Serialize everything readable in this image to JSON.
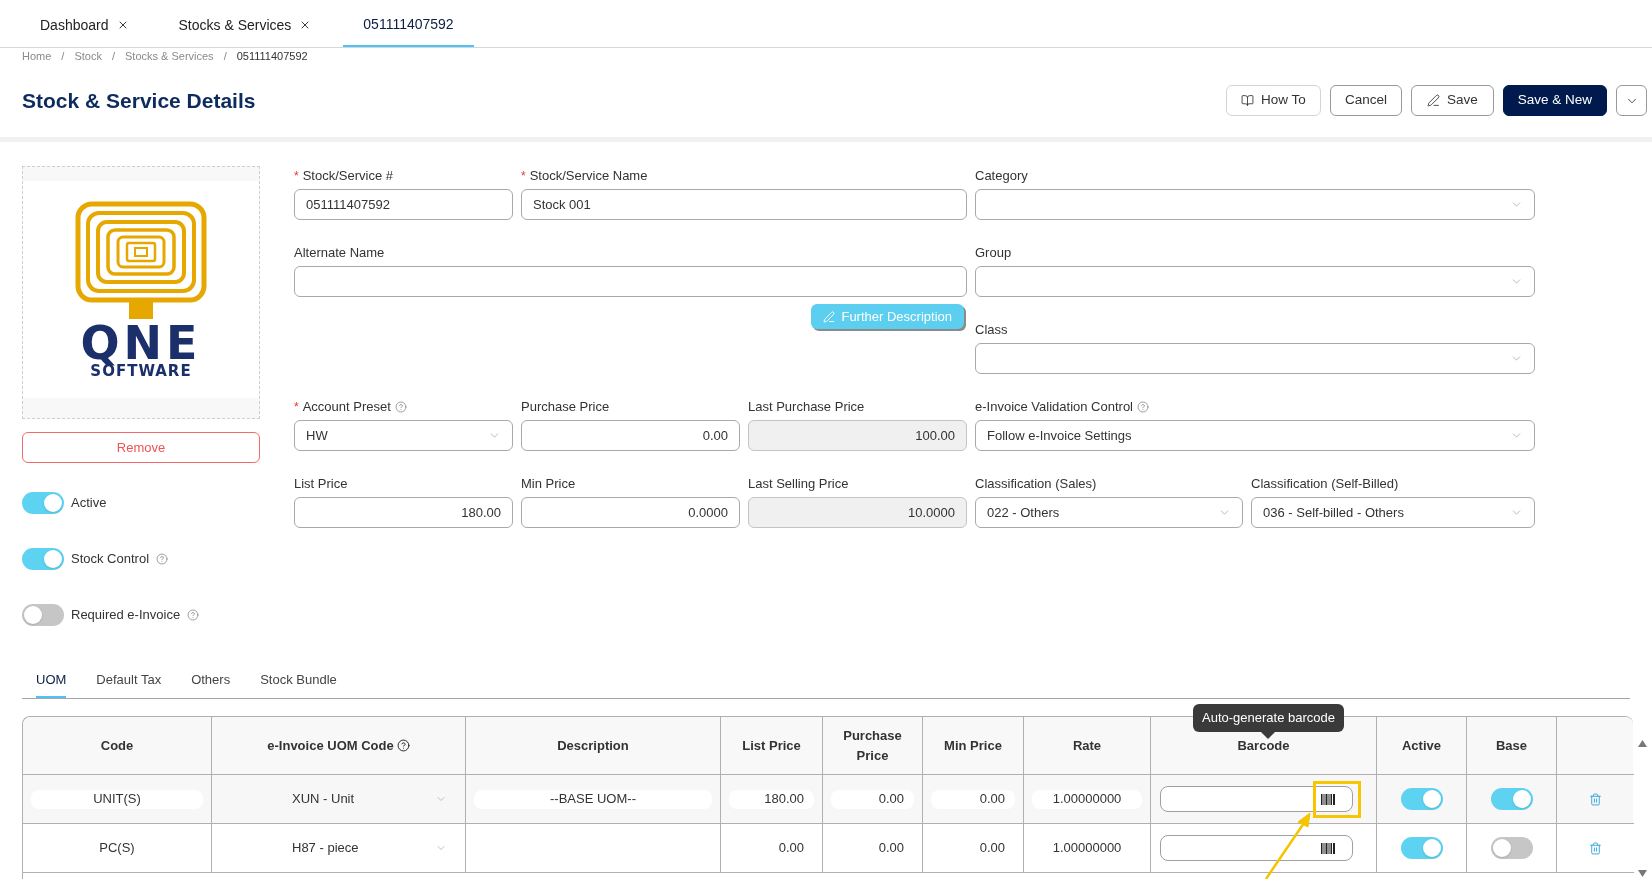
{
  "tabs": [
    {
      "label": "Dashboard",
      "closable": true,
      "selected": false
    },
    {
      "label": "Stocks & Services",
      "closable": true,
      "selected": false
    },
    {
      "label": "051111407592",
      "closable": false,
      "selected": true
    }
  ],
  "breadcrumb": [
    "Home",
    "Stock",
    "Stocks & Services",
    "051111407592"
  ],
  "title": "Stock & Service Details",
  "actions": [
    {
      "kind": "book",
      "label": "How To"
    },
    {
      "kind": "plain",
      "label": "Cancel"
    },
    {
      "kind": "pencil",
      "label": "Save"
    },
    {
      "kind": "primary",
      "label": "Save & New"
    },
    {
      "kind": "dropdown"
    }
  ],
  "image": {
    "logo_text": "QNE",
    "logo_subtext": "SOFTWARE"
  },
  "remove_button": "Remove",
  "toggles": [
    {
      "label": "Active",
      "on": true,
      "help": false
    },
    {
      "label": "Stock Control",
      "on": true,
      "help": true
    },
    {
      "label": "Required e-Invoice",
      "on": false,
      "help": true
    }
  ],
  "fields": [
    {
      "label": "Stock/Service #",
      "required": true,
      "help": false,
      "kind": "text",
      "value": "051111407592"
    },
    {
      "label": "Stock/Service Name",
      "required": true,
      "help": false,
      "kind": "text",
      "value": "Stock 001"
    },
    {
      "label": "Category",
      "required": false,
      "help": false,
      "kind": "select"
    },
    {
      "label": "Alternate Name",
      "required": false,
      "help": false,
      "kind": "text"
    },
    {
      "label": "Group",
      "required": false,
      "help": false,
      "kind": "select"
    },
    {
      "label": "Class",
      "required": false,
      "help": false,
      "kind": "select"
    },
    {
      "label": "Account Preset",
      "required": true,
      "help": true,
      "kind": "select",
      "value": "HW"
    },
    {
      "label": "Purchase Price",
      "required": false,
      "help": false,
      "kind": "number",
      "value": "0.00"
    },
    {
      "label": "Last Purchase Price",
      "required": false,
      "help": false,
      "kind": "readonly",
      "value": "100.00"
    },
    {
      "label": "e-Invoice Validation Control",
      "required": false,
      "help": true,
      "kind": "select",
      "value": "Follow e-Invoice Settings"
    },
    {
      "label": "List Price",
      "required": false,
      "help": false,
      "kind": "number",
      "value": "180.00"
    },
    {
      "label": "Min Price",
      "required": false,
      "help": false,
      "kind": "number",
      "value": "0.0000"
    },
    {
      "label": "Last Selling Price",
      "required": false,
      "help": false,
      "kind": "readonly",
      "value": "10.0000"
    },
    {
      "label": "Classification (Sales)",
      "required": false,
      "help": false,
      "kind": "select",
      "value": "022 - Others"
    },
    {
      "label": "Classification (Self-Billed)",
      "required": false,
      "help": false,
      "kind": "select",
      "value": "036 - Self-billed - Others"
    }
  ],
  "further_description": "Further Description",
  "detail_tabs": [
    {
      "label": "UOM",
      "selected": true
    },
    {
      "label": "Default Tax",
      "selected": false
    },
    {
      "label": "Others",
      "selected": false
    },
    {
      "label": "Stock Bundle",
      "selected": false
    }
  ],
  "table": {
    "columns": [
      {
        "label": "Code",
        "help": false
      },
      {
        "label": "e-Invoice UOM Code",
        "help": true
      },
      {
        "label": "Description",
        "help": false
      },
      {
        "label": "List Price",
        "help": false
      },
      {
        "label": "Purchase Price",
        "help": false
      },
      {
        "label": "Min Price",
        "help": false
      },
      {
        "label": "Rate",
        "help": false
      },
      {
        "label": "Barcode",
        "help": false
      },
      {
        "label": "Active",
        "help": false
      },
      {
        "label": "Base",
        "help": false
      }
    ],
    "rows": [
      {
        "editing": true,
        "code": "UNIT(S)",
        "uom_code": "XUN - Unit",
        "description": "--BASE UOM--",
        "list_price": "180.00",
        "purchase_price": "0.00",
        "min_price": "0.00",
        "rate": "1.00000000",
        "active": true,
        "base": true
      },
      {
        "editing": false,
        "code": "PC(S)",
        "uom_code": "H87 - piece",
        "list_price": "0.00",
        "purchase_price": "0.00",
        "min_price": "0.00",
        "rate": "1.00000000",
        "active": true,
        "base": false
      }
    ]
  },
  "tooltip": "Auto-generate barcode",
  "breadcrumb_separator": "/",
  "required_mark": "*"
}
